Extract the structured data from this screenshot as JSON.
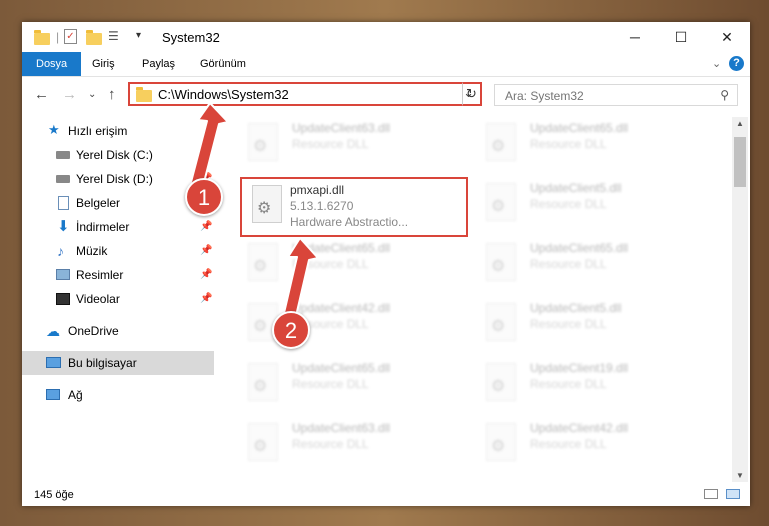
{
  "window": {
    "title": "System32",
    "min": "─",
    "max": "☐",
    "close": "✕"
  },
  "ribbon": {
    "tabs": [
      "Dosya",
      "Giriş",
      "Paylaş",
      "Görünüm"
    ],
    "help": "?"
  },
  "address": {
    "path": "C:\\Windows\\System32",
    "dropdown": "⌄",
    "refresh": "↻"
  },
  "search": {
    "placeholder": "Ara: System32"
  },
  "nav": {
    "quick_access": "Hızlı erişim",
    "items": [
      "Yerel Disk (C:)",
      "Yerel Disk (D:)",
      "Belgeler",
      "İndirmeler",
      "Müzik",
      "Resimler",
      "Videolar"
    ],
    "onedrive": "OneDrive",
    "this_pc": "Bu bilgisayar",
    "network": "Ağ"
  },
  "files": {
    "selected": {
      "name": "pmxapi.dll",
      "version": "5.13.1.6270",
      "desc": "Hardware Abstractio..."
    },
    "left": [
      {
        "name": "UpdateClient63.dll",
        "desc": "Resource DLL"
      },
      {
        "name": "UpdateClient65.dll",
        "desc": "Resource DLL"
      },
      {
        "name": "UpdateClient42.dll",
        "desc": "Resource DLL"
      },
      {
        "name": "UpdateClient65.dll",
        "desc": "Resource DLL"
      },
      {
        "name": "UpdateClient63.dll",
        "desc": "Resource DLL"
      }
    ],
    "right": [
      {
        "name": "UpdateClient65.dll",
        "desc": "Resource DLL"
      },
      {
        "name": "UpdateClient5.dll",
        "desc": "Resource DLL"
      },
      {
        "name": "UpdateClient65.dll",
        "desc": "Resource DLL"
      },
      {
        "name": "UpdateClient5.dll",
        "desc": "Resource DLL"
      },
      {
        "name": "UpdateClient19.dll",
        "desc": "Resource DLL"
      },
      {
        "name": "UpdateClient42.dll",
        "desc": "Resource DLL"
      }
    ]
  },
  "status": {
    "count": "145 öğe"
  },
  "annotations": {
    "one": "1",
    "two": "2",
    "color": "#d9453a"
  }
}
